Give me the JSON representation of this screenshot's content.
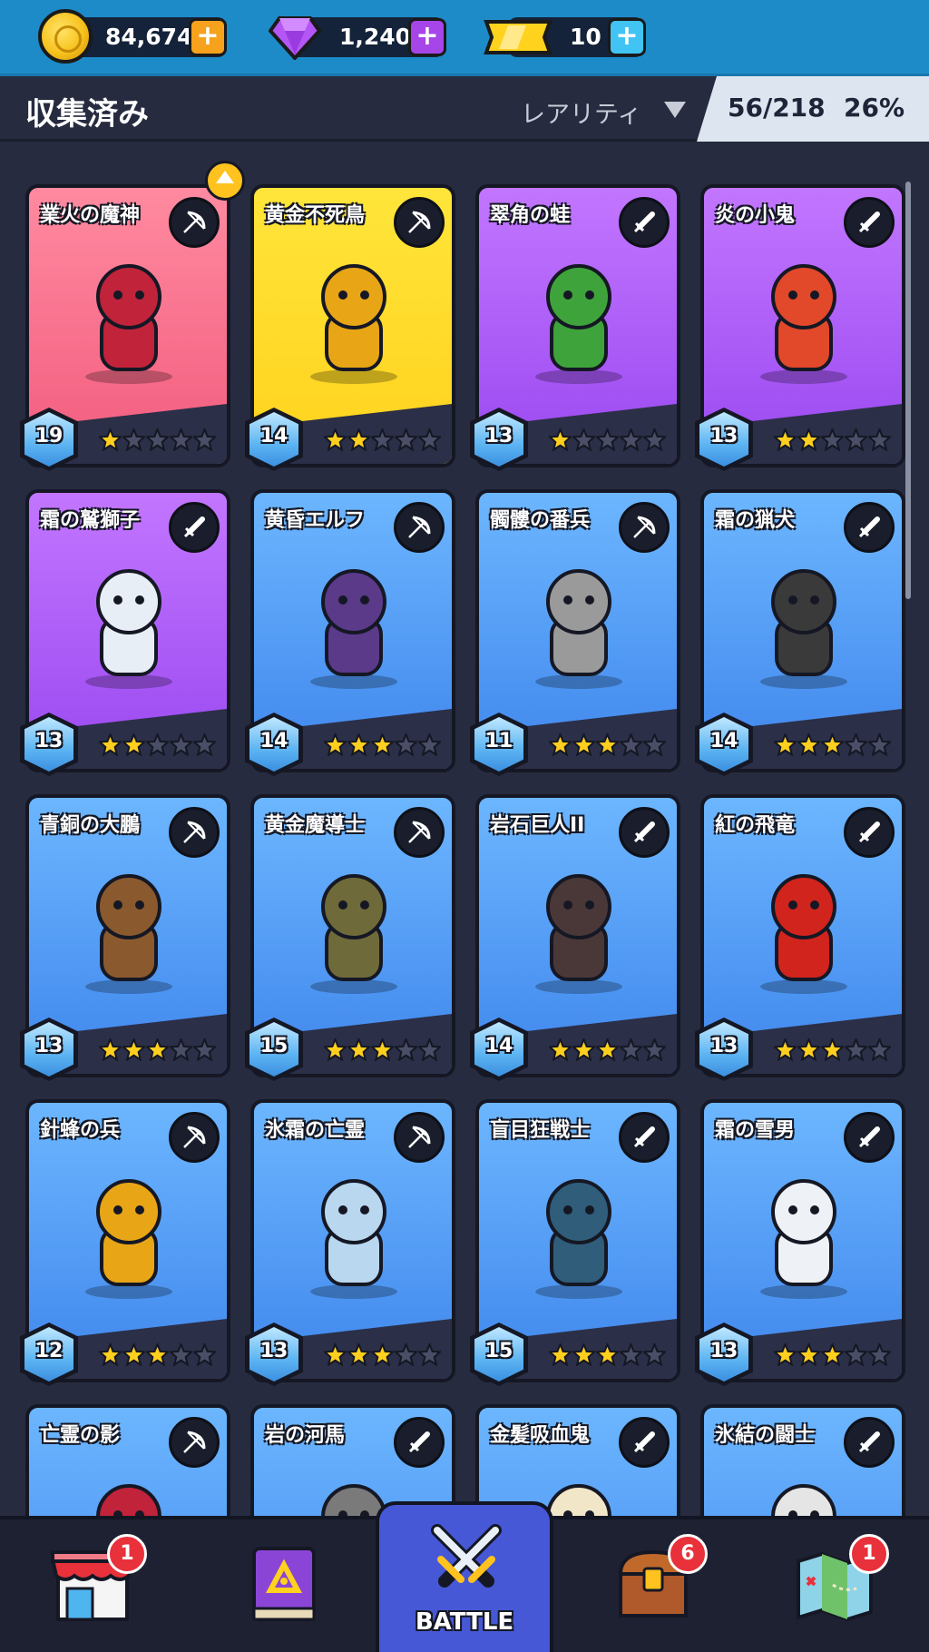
{
  "currency": {
    "coins": "84,674",
    "gems": "1,240",
    "tickets": "10"
  },
  "header": {
    "title": "収集済み",
    "sort_label": "レアリティ",
    "collected": "56/218",
    "percent": "26%"
  },
  "cards": [
    {
      "name": "業火の魔神",
      "level": "19",
      "stars": 1,
      "max_stars": 5,
      "rarity": "legendary-red",
      "weapon": "bow-icon",
      "color": "#c0233a",
      "upgrade": true
    },
    {
      "name": "黄金不死鳥",
      "level": "14",
      "stars": 2,
      "max_stars": 5,
      "rarity": "legendary-gold",
      "weapon": "bow-icon",
      "color": "#e8a516"
    },
    {
      "name": "翠角の蛙",
      "level": "13",
      "stars": 1,
      "max_stars": 5,
      "rarity": "epic",
      "weapon": "sword-icon",
      "color": "#3fa33b"
    },
    {
      "name": "炎の小鬼",
      "level": "13",
      "stars": 2,
      "max_stars": 5,
      "rarity": "epic",
      "weapon": "sword-icon",
      "color": "#e2482a"
    },
    {
      "name": "霜の鷲獅子",
      "level": "13",
      "stars": 2,
      "max_stars": 5,
      "rarity": "epic",
      "weapon": "sword-icon",
      "color": "#e8eef5"
    },
    {
      "name": "黄昏エルフ",
      "level": "14",
      "stars": 3,
      "max_stars": 5,
      "rarity": "rare",
      "weapon": "bow-icon",
      "color": "#5b3a8a"
    },
    {
      "name": "髑髏の番兵",
      "level": "11",
      "stars": 3,
      "max_stars": 5,
      "rarity": "rare",
      "weapon": "bow-icon",
      "color": "#9a9a9a"
    },
    {
      "name": "霜の猟犬",
      "level": "14",
      "stars": 3,
      "max_stars": 5,
      "rarity": "rare",
      "weapon": "sword-icon",
      "color": "#3a3a3a"
    },
    {
      "name": "青銅の大鵬",
      "level": "13",
      "stars": 3,
      "max_stars": 5,
      "rarity": "rare",
      "weapon": "bow-icon",
      "color": "#8a5a2e"
    },
    {
      "name": "黄金魔導士",
      "level": "15",
      "stars": 3,
      "max_stars": 5,
      "rarity": "rare",
      "weapon": "bow-icon",
      "color": "#6f6a3a"
    },
    {
      "name": "岩石巨人II",
      "level": "14",
      "stars": 3,
      "max_stars": 5,
      "rarity": "rare",
      "weapon": "sword-icon",
      "color": "#4a3838"
    },
    {
      "name": "紅の飛竜",
      "level": "13",
      "stars": 3,
      "max_stars": 5,
      "rarity": "rare",
      "weapon": "sword-icon",
      "color": "#d1241c"
    },
    {
      "name": "針蜂の兵",
      "level": "12",
      "stars": 3,
      "max_stars": 5,
      "rarity": "rare",
      "weapon": "bow-icon",
      "color": "#e8a516"
    },
    {
      "name": "氷霜の亡霊",
      "level": "13",
      "stars": 3,
      "max_stars": 5,
      "rarity": "rare",
      "weapon": "bow-icon",
      "color": "#b9d7ef"
    },
    {
      "name": "盲目狂戦士",
      "level": "15",
      "stars": 3,
      "max_stars": 5,
      "rarity": "rare",
      "weapon": "sword-icon",
      "color": "#2f5d7a"
    },
    {
      "name": "霜の雪男",
      "level": "13",
      "stars": 3,
      "max_stars": 5,
      "rarity": "rare",
      "weapon": "sword-icon",
      "color": "#eef2f6"
    },
    {
      "name": "亡霊の影",
      "level": "",
      "stars": 0,
      "max_stars": 5,
      "rarity": "rare",
      "weapon": "bow-icon",
      "color": "#c0233a"
    },
    {
      "name": "岩の河馬",
      "level": "",
      "stars": 0,
      "max_stars": 5,
      "rarity": "rare",
      "weapon": "sword-icon",
      "color": "#7a7a7a"
    },
    {
      "name": "金髪吸血鬼",
      "level": "",
      "stars": 0,
      "max_stars": 5,
      "rarity": "rare",
      "weapon": "sword-icon",
      "color": "#f2e6c8"
    },
    {
      "name": "氷結の闘士",
      "level": "",
      "stars": 0,
      "max_stars": 5,
      "rarity": "rare",
      "weapon": "sword-icon",
      "color": "#e5e5e5"
    }
  ],
  "nav": {
    "shop_badge": "1",
    "battle_label": "BATTLE",
    "chest_badge": "6",
    "map_badge": "1"
  }
}
